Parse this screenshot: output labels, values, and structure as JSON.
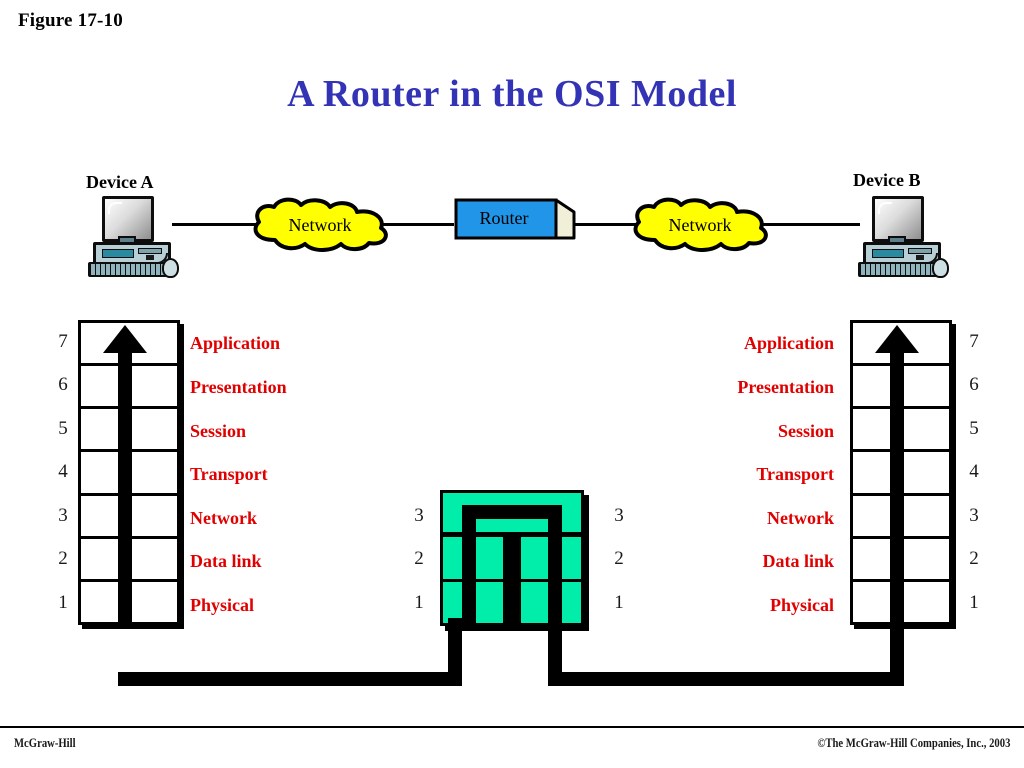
{
  "figure": {
    "label": "Figure 17-10"
  },
  "title": "A Router in the OSI Model",
  "topology": {
    "device_a_label": "Device A",
    "device_b_label": "Device B",
    "cloud_left_label": "Network",
    "cloud_right_label": "Network",
    "router_label": "Router",
    "colors": {
      "cloud_fill": "#ffff00",
      "router_fill": "#2196e8",
      "router_side": "#f2efd8",
      "wire": "#000000"
    }
  },
  "osi": {
    "layers": [
      {
        "number": "7",
        "name": "Application"
      },
      {
        "number": "6",
        "name": "Presentation"
      },
      {
        "number": "5",
        "name": "Session"
      },
      {
        "number": "4",
        "name": "Transport"
      },
      {
        "number": "3",
        "name": "Network"
      },
      {
        "number": "2",
        "name": "Data link"
      },
      {
        "number": "1",
        "name": "Physical"
      }
    ],
    "layer_name_color": "#e00000",
    "number_color": "#1a1a1a"
  },
  "router_stack": {
    "left_numbers": [
      "3",
      "2",
      "1"
    ],
    "right_numbers": [
      "3",
      "2",
      "1"
    ],
    "fill_color": "#00eeaa",
    "border_color": "#000000"
  },
  "footer": {
    "left": "McGraw-Hill",
    "right": "©The McGraw-Hill Companies, Inc., 2003"
  },
  "accents": {
    "title_color": "#3333b5",
    "path_color": "#000000"
  }
}
